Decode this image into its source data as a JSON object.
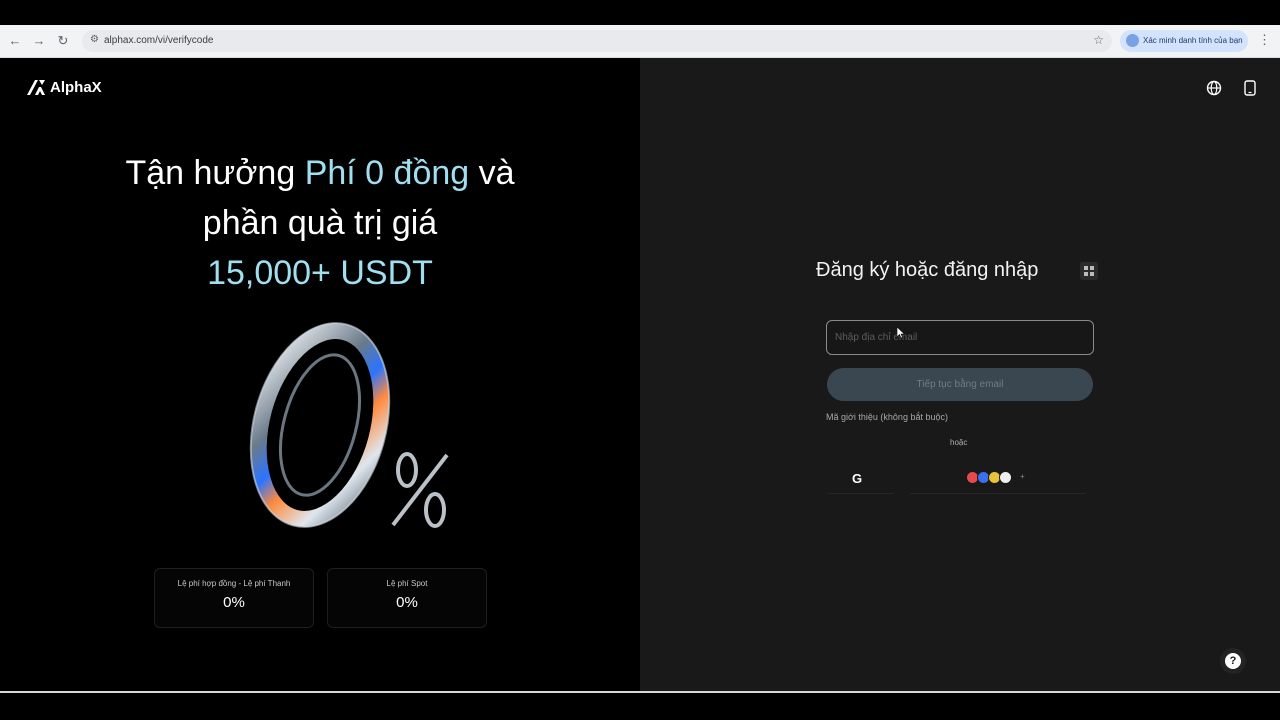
{
  "browser": {
    "url": "alphax.com/vi/verifycode",
    "translate_chip": "Xác minh danh tính của bạn"
  },
  "brand": {
    "name": "AlphaX"
  },
  "hero": {
    "line1_prefix": "Tận hưởng ",
    "line1_highlight": "Phí 0 đồng",
    "line1_suffix": " và",
    "line2": "phần quà trị giá",
    "line3_highlight": "15,000+ USDT",
    "art_text": "0%"
  },
  "fees": [
    {
      "label": "Lệ phí hợp đồng - Lệ phí Thanh",
      "value": "0%"
    },
    {
      "label": "Lệ phí Spot",
      "value": "0%"
    }
  ],
  "auth": {
    "title": "Đăng ký hoặc đăng nhập",
    "input_placeholder": "Nhập địa chỉ email",
    "continue_label": "Tiếp tục bằng email",
    "referral": "Mã giới thiệu (không bắt buộc)",
    "or": "hoặc",
    "google": "G",
    "wallets_more": "+"
  },
  "colors": {
    "highlight": "#9fdff0",
    "right_panel": "#191919"
  },
  "icons": [
    "back-icon",
    "forward-icon",
    "reload-icon",
    "site-info-icon",
    "star-icon",
    "translate-icon",
    "menu-dots-icon",
    "globe-icon",
    "phone-icon",
    "qr-code-icon",
    "google-icon",
    "wallet-icons",
    "help-icon"
  ]
}
